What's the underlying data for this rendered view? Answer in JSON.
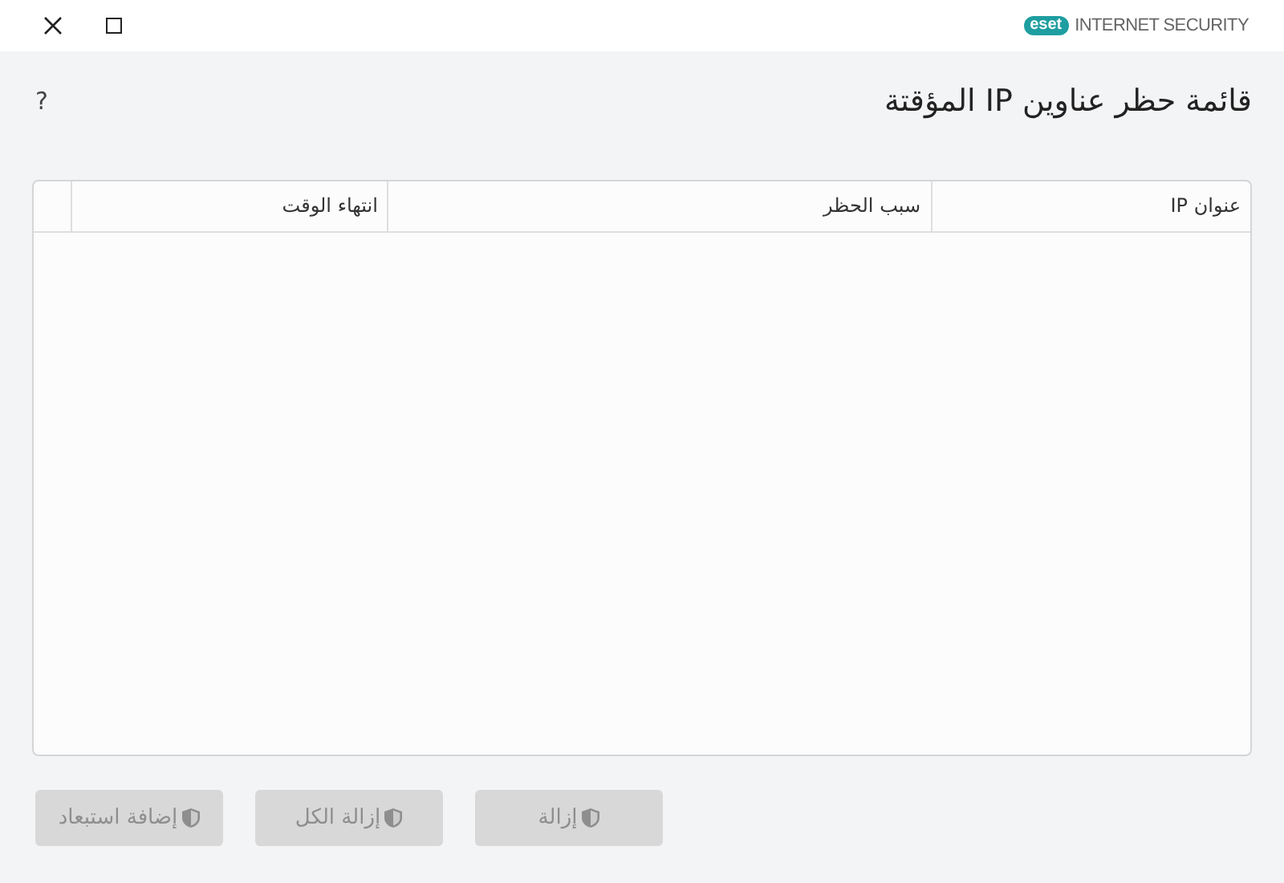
{
  "window": {
    "logo": "eset",
    "product": "INTERNET SECURITY"
  },
  "page": {
    "title": "قائمة حظر عناوين IP المؤقتة",
    "help": "?"
  },
  "table": {
    "columns": [
      "عنوان IP",
      "سبب الحظر",
      "انتهاء الوقت",
      ""
    ]
  },
  "buttons": [
    {
      "label": "إزالة",
      "disabled": true
    },
    {
      "label": "إزالة الكل",
      "disabled": true
    },
    {
      "label": "إضافة استبعاد",
      "disabled": true
    }
  ]
}
